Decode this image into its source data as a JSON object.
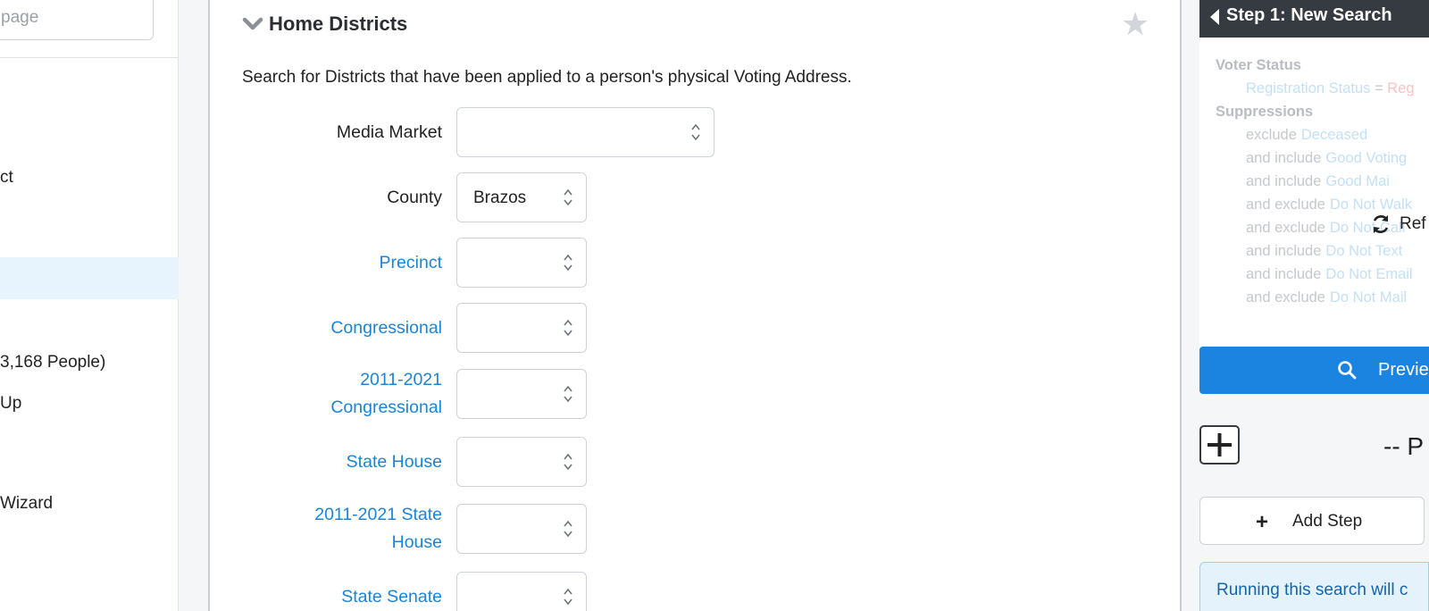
{
  "sidebar": {
    "search_placeholder": "page",
    "items": [
      {
        "label": "ct"
      },
      {
        "label": "3,168 People)"
      },
      {
        "label": "Up"
      },
      {
        "label": "Wizard"
      }
    ]
  },
  "main": {
    "title": "Home Districts",
    "description": "Search for Districts that have been applied to a person's physical Voting Address.",
    "fields": [
      {
        "label_lines": [
          "Media Market"
        ],
        "value": "",
        "style": "dark"
      },
      {
        "label_lines": [
          "County"
        ],
        "value": "Brazos",
        "style": "dark"
      },
      {
        "label_lines": [
          "Precinct"
        ],
        "value": "",
        "style": "link"
      },
      {
        "label_lines": [
          "Congressional"
        ],
        "value": "",
        "style": "link"
      },
      {
        "label_lines": [
          "2011-2021",
          "Congressional"
        ],
        "value": "",
        "style": "link"
      },
      {
        "label_lines": [
          "State House"
        ],
        "value": "",
        "style": "link"
      },
      {
        "label_lines": [
          "2011-2021 State",
          "House"
        ],
        "value": "",
        "style": "link"
      },
      {
        "label_lines": [
          "State Senate"
        ],
        "value": "",
        "style": "link"
      }
    ]
  },
  "right": {
    "step_title": "Step 1: New Search",
    "criteria": {
      "voter_status": "Voter Status",
      "registration_label": "Registration Status",
      "equals": "=",
      "registration_value": "Reg",
      "suppressions": "Suppressions",
      "rules": [
        {
          "prefix": "exclude",
          "name": "Deceased"
        },
        {
          "prefix": "and include",
          "name": "Good Voting"
        },
        {
          "prefix": "and include",
          "name": "Good Mai"
        },
        {
          "prefix": "and exclude",
          "name": "Do Not Walk"
        },
        {
          "prefix": "and exclude",
          "name": "Do Not Call"
        },
        {
          "prefix": "and include",
          "name": "Do Not Text"
        },
        {
          "prefix": "and include",
          "name": "Do Not Email"
        },
        {
          "prefix": "and exclude",
          "name": "Do Not Mail"
        }
      ]
    },
    "refresh_label": "Ref",
    "preview_label": "Previe",
    "dash_label": "-- P",
    "add_step_label": "Add Step",
    "info_text": "Running this search will c"
  },
  "colors": {
    "link": "#1b84d6",
    "primary_button": "#1a84e0",
    "dark_bar": "#353b41",
    "active_row": "#e7f4fd",
    "info_bg": "#e4f2fb"
  }
}
